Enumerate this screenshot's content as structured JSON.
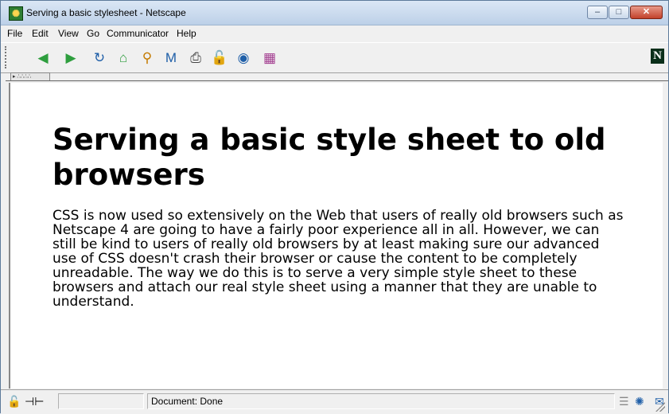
{
  "window": {
    "title": "Serving a basic stylesheet - Netscape",
    "controls": {
      "minimize": "–",
      "maximize": "□",
      "close": "✕"
    }
  },
  "menu": [
    "File",
    "Edit",
    "View",
    "Go",
    "Communicator",
    "Help"
  ],
  "toolbar": {
    "buttons": [
      {
        "name": "back",
        "glyph": "◀",
        "color": "#2e9e3e"
      },
      {
        "name": "forward",
        "glyph": "▶",
        "color": "#2e9e3e"
      },
      {
        "name": "reload",
        "glyph": "↻",
        "color": "#1f5fa8"
      },
      {
        "name": "home",
        "glyph": "⌂",
        "color": "#2e9e3e"
      },
      {
        "name": "search",
        "glyph": "⚲",
        "color": "#c47a00"
      },
      {
        "name": "my-netscape",
        "glyph": "M",
        "color": "#1f5fa8"
      },
      {
        "name": "print",
        "glyph": "⎙",
        "color": "#444444"
      },
      {
        "name": "security",
        "glyph": "🔓",
        "color": "#c9a400"
      },
      {
        "name": "shop",
        "glyph": "◉",
        "color": "#1f5fa8"
      },
      {
        "name": "stop",
        "glyph": "▦",
        "color": "#a23b8f"
      }
    ],
    "brand_logo": "N"
  },
  "page": {
    "heading": "Serving a basic style sheet to old browsers",
    "body": "CSS is now used so extensively on the Web that users of really old browsers such as Netscape 4 are going to have a fairly poor experience all in all. However, we can still be kind to users of really old browsers by at least making sure our advanced use of CSS doesn't crash their browser or cause the content to be completely unreadable. The way we do this is to serve a very simple style sheet to these browsers and attach our real style sheet using a manner that they are unable to understand."
  },
  "status": {
    "text": "Document: Done",
    "component_icons": [
      {
        "name": "navigator",
        "glyph": "✺"
      },
      {
        "name": "mail",
        "glyph": "✉"
      },
      {
        "name": "discussions",
        "glyph": "☍"
      },
      {
        "name": "address-book",
        "glyph": "▣"
      },
      {
        "name": "composer",
        "glyph": "✎"
      }
    ]
  }
}
